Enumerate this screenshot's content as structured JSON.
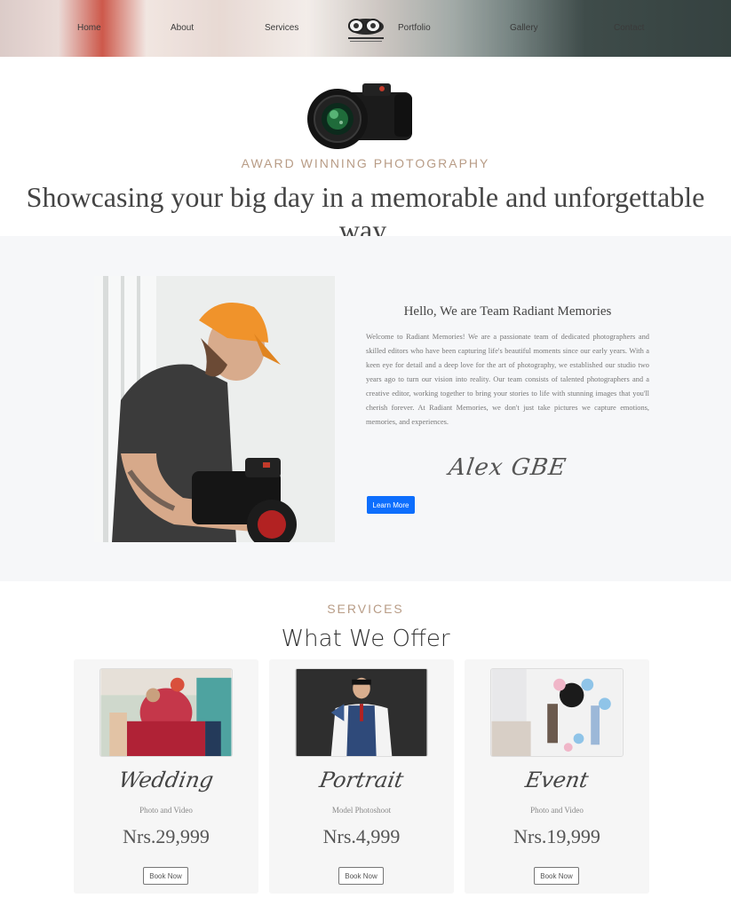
{
  "nav": {
    "items": [
      "Home",
      "About",
      "Services",
      "Portfolio",
      "Gallery",
      "Contact"
    ]
  },
  "hero": {
    "eyebrow": "AWARD WINNING PHOTOGRAPHY",
    "title": "Showcasing your big day in a memorable and unforgettable way."
  },
  "about": {
    "heading": "Hello, We are Team Radiant Memories",
    "text": "Welcome to Radiant Memories! We are a passionate team of dedicated photographers and skilled editors who have been capturing life's beautiful moments since our early years. With a keen eye for detail and a deep love for the art of photography, we established our studio two years ago to turn our vision into reality. Our team consists of talented photographers and a creative editor, working together to bring your stories to life with stunning images that you'll cherish forever. At Radiant Memories, we don't just take pictures we capture emotions, memories, and experiences.",
    "signature": "Alex GBE",
    "button": "Learn More"
  },
  "services": {
    "eyebrow": "SERVICES",
    "title": "What We Offer",
    "cards": [
      {
        "name": "Wedding",
        "sub": "Photo and Video",
        "price": "Nrs.29,999",
        "button": "Book Now"
      },
      {
        "name": "Portrait",
        "sub": "Model Photoshoot",
        "price": "Nrs.4,999",
        "button": "Book Now"
      },
      {
        "name": "Event",
        "sub": "Photo and Video",
        "price": "Nrs.19,999",
        "button": "Book Now"
      }
    ]
  },
  "colors": {
    "accent": "#b89c86",
    "primary_button": "#0d6efd",
    "section_bg": "#f6f7f9"
  }
}
